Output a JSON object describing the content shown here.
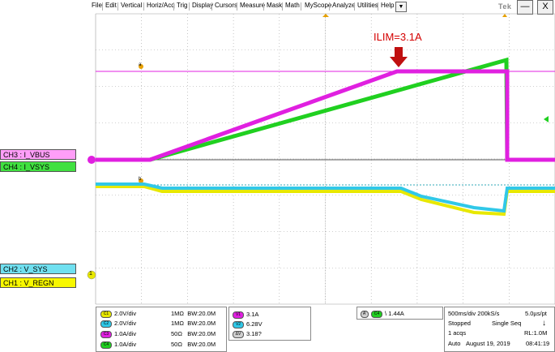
{
  "menu": {
    "items": [
      "File",
      "Edit",
      "Vertical",
      "Horiz/Acq",
      "Trig",
      "Display",
      "Cursors",
      "Measure",
      "Mask",
      "Math",
      "MyScope",
      "Analyze",
      "Utilities",
      "Help"
    ],
    "dropdown_glyph": "▼",
    "logo": "Tek",
    "minimize_label": "—",
    "close_label": "X"
  },
  "annotation": {
    "text": "ILIM=3.1A",
    "color": "#d40000"
  },
  "channel_labels": {
    "ch3": "CH3 : I_VBUS",
    "ch4": "CH4 : I_VSYS",
    "ch2": "CH2 : V_SYS",
    "ch1": "CH1 : V_REGN"
  },
  "markers": {
    "ref_a": "a",
    "ref_b": "b",
    "ch1_marker": "1"
  },
  "colors": {
    "ch1": "#e8e800",
    "ch2": "#30c8e8",
    "ch3": "#e020e0",
    "ch4": "#20d020",
    "grid": "#a0a0a0",
    "arrow": "#c01010"
  },
  "channel_settings": [
    {
      "badge": "C1",
      "scale": "2.0V/div",
      "impedance": "1MΩ",
      "bw": "W:20.0M",
      "color": "#e8e800"
    },
    {
      "badge": "C2",
      "scale": "2.0V/div",
      "impedance": "1MΩ",
      "bw": "W:20.0M",
      "color": "#30c8e8"
    },
    {
      "badge": "C3",
      "scale": "1.0A/div",
      "impedance": "50Ω",
      "bw": "W:20.0M",
      "color": "#e020e0"
    },
    {
      "badge": "C4",
      "scale": "1.0A/div",
      "impedance": "50Ω",
      "bw": "W:20.0M",
      "color": "#20d020"
    }
  ],
  "cursors": [
    {
      "badge": "V1",
      "value": "3.1A",
      "color": "#e020e0"
    },
    {
      "badge": "V2",
      "value": "6.28V",
      "color": "#30c8e8"
    },
    {
      "badge": "ΔV",
      "value": "3.18?",
      "color": "#d0d0d0"
    }
  ],
  "trigger": {
    "source_badge": "A'",
    "channel_badge": "C4",
    "slope": "\\",
    "level": "1.44A"
  },
  "acquisition": {
    "timebase": "500ms/div",
    "sample_rate": "200kS/s",
    "resolution": "5.0µs/pt",
    "state": "Stopped",
    "mode": "Single Seq",
    "acqs": "1 acqs",
    "record_length": "RL:1.0M",
    "trigger_mode": "Auto",
    "date": "August 19, 2019",
    "time": "08:41:19"
  }
}
